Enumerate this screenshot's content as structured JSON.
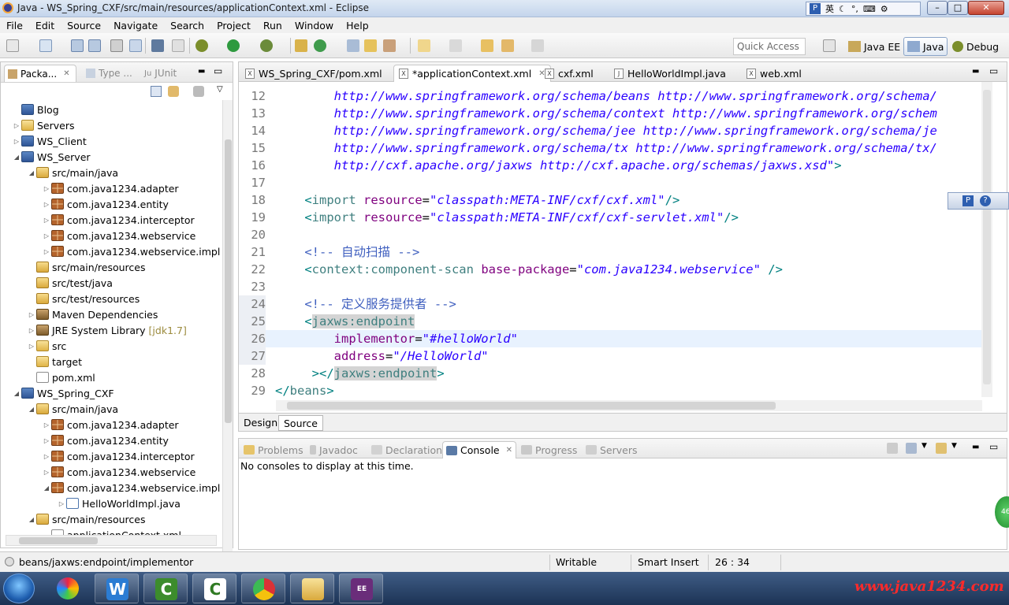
{
  "window": {
    "title": "Java - WS_Spring_CXF/src/main/resources/applicationContext.xml - Eclipse",
    "ime_label": "英"
  },
  "menu": [
    "File",
    "Edit",
    "Source",
    "Navigate",
    "Search",
    "Project",
    "Run",
    "Window",
    "Help"
  ],
  "toolbar": {
    "quick_access_placeholder": "Quick Access",
    "perspectives": [
      {
        "label": "Java EE",
        "active": false
      },
      {
        "label": "Java",
        "active": true
      },
      {
        "label": "Debug",
        "active": false
      }
    ]
  },
  "package_explorer": {
    "tabs": [
      {
        "label": "Packa...",
        "active": true
      },
      {
        "label": "Type ...",
        "active": false
      },
      {
        "label": "JUnit",
        "active": false
      }
    ],
    "items": [
      {
        "label": "Blog",
        "icon": "project-icon",
        "depth": 0,
        "expanded": null
      },
      {
        "label": "Servers",
        "icon": "folder-icon",
        "depth": 0,
        "expanded": false
      },
      {
        "label": "WS_Client",
        "icon": "project-icon",
        "depth": 0,
        "expanded": false
      },
      {
        "label": "WS_Server",
        "icon": "project-icon",
        "depth": 0,
        "expanded": true
      },
      {
        "label": "src/main/java",
        "icon": "source-folder-icon",
        "depth": 1,
        "expanded": true
      },
      {
        "label": "com.java1234.adapter",
        "icon": "package-icon",
        "depth": 2,
        "expanded": false
      },
      {
        "label": "com.java1234.entity",
        "icon": "package-icon",
        "depth": 2,
        "expanded": false
      },
      {
        "label": "com.java1234.interceptor",
        "icon": "package-icon",
        "depth": 2,
        "expanded": false
      },
      {
        "label": "com.java1234.webservice",
        "icon": "package-icon",
        "depth": 2,
        "expanded": false
      },
      {
        "label": "com.java1234.webservice.impl",
        "icon": "package-icon",
        "depth": 2,
        "expanded": false
      },
      {
        "label": "src/main/resources",
        "icon": "source-folder-icon",
        "depth": 1,
        "expanded": null
      },
      {
        "label": "src/test/java",
        "icon": "source-folder-icon",
        "depth": 1,
        "expanded": null
      },
      {
        "label": "src/test/resources",
        "icon": "source-folder-icon",
        "depth": 1,
        "expanded": null
      },
      {
        "label": "Maven Dependencies",
        "icon": "library-icon",
        "depth": 1,
        "expanded": false
      },
      {
        "label": "JRE System Library",
        "decoration": "[jdk1.7]",
        "icon": "library-icon",
        "depth": 1,
        "expanded": false
      },
      {
        "label": "src",
        "icon": "folder-icon",
        "depth": 1,
        "expanded": false
      },
      {
        "label": "target",
        "icon": "folder-icon",
        "depth": 1,
        "expanded": null
      },
      {
        "label": "pom.xml",
        "icon": "xml-file-icon",
        "depth": 1,
        "expanded": null
      },
      {
        "label": "WS_Spring_CXF",
        "icon": "project-icon",
        "depth": 0,
        "expanded": true
      },
      {
        "label": "src/main/java",
        "icon": "source-folder-icon",
        "depth": 1,
        "expanded": true
      },
      {
        "label": "com.java1234.adapter",
        "icon": "package-icon",
        "depth": 2,
        "expanded": false
      },
      {
        "label": "com.java1234.entity",
        "icon": "package-icon",
        "depth": 2,
        "expanded": false
      },
      {
        "label": "com.java1234.interceptor",
        "icon": "package-icon",
        "depth": 2,
        "expanded": false
      },
      {
        "label": "com.java1234.webservice",
        "icon": "package-icon",
        "depth": 2,
        "expanded": false
      },
      {
        "label": "com.java1234.webservice.impl",
        "icon": "package-icon",
        "depth": 2,
        "expanded": true
      },
      {
        "label": "HelloWorldImpl.java",
        "icon": "java-file-icon",
        "depth": 3,
        "expanded": false
      },
      {
        "label": "src/main/resources",
        "icon": "source-folder-icon",
        "depth": 1,
        "expanded": true
      },
      {
        "label": "applicationContext.xml",
        "icon": "xml-file-icon",
        "depth": 2,
        "expanded": null
      }
    ]
  },
  "editor": {
    "tabs": [
      {
        "label": "WS_Spring_CXF/pom.xml",
        "active": false
      },
      {
        "label": "*applicationContext.xml",
        "active": true
      },
      {
        "label": "cxf.xml",
        "active": false
      },
      {
        "label": "HelloWorldImpl.java",
        "active": false
      },
      {
        "label": "web.xml",
        "active": false
      }
    ],
    "current_line": 26,
    "lines": [
      {
        "n": 12,
        "parts": [
          [
            "url",
            "        http://www.springframework.org/schema/beans http://www.springframework.org/schema/"
          ]
        ]
      },
      {
        "n": 13,
        "parts": [
          [
            "url",
            "        http://www.springframework.org/schema/context http://www.springframework.org/schem"
          ]
        ]
      },
      {
        "n": 14,
        "parts": [
          [
            "url",
            "        http://www.springframework.org/schema/jee http://www.springframework.org/schema/je"
          ]
        ]
      },
      {
        "n": 15,
        "parts": [
          [
            "url",
            "        http://www.springframework.org/schema/tx http://www.springframework.org/schema/tx/"
          ]
        ]
      },
      {
        "n": 16,
        "parts": [
          [
            "url",
            "        http://cxf.apache.org/jaxws http://cxf.apache.org/schemas/jaxws.xsd\""
          ],
          [
            "bracket",
            ">"
          ]
        ]
      },
      {
        "n": 17,
        "parts": []
      },
      {
        "n": 18,
        "parts": [
          [
            "bracket",
            "    <"
          ],
          [
            "tag",
            "import "
          ],
          [
            "attr",
            "resource"
          ],
          [
            "plain",
            "="
          ],
          [
            "str",
            "\"classpath:META-INF/cxf/cxf.xml\""
          ],
          [
            "bracket",
            "/>"
          ]
        ]
      },
      {
        "n": 19,
        "parts": [
          [
            "bracket",
            "    <"
          ],
          [
            "tag",
            "import "
          ],
          [
            "attr",
            "resource"
          ],
          [
            "plain",
            "="
          ],
          [
            "str",
            "\"classpath:META-INF/cxf/cxf-servlet.xml\""
          ],
          [
            "bracket",
            "/>"
          ]
        ]
      },
      {
        "n": 20,
        "parts": []
      },
      {
        "n": 21,
        "parts": [
          [
            "cmt",
            "    <!-- 自动扫描 -->"
          ]
        ]
      },
      {
        "n": 22,
        "parts": [
          [
            "bracket",
            "    <"
          ],
          [
            "tag",
            "context:component-scan "
          ],
          [
            "attr",
            "base-package"
          ],
          [
            "plain",
            "="
          ],
          [
            "str",
            "\"com.java1234.webservice\""
          ],
          [
            "bracket",
            " />"
          ]
        ]
      },
      {
        "n": 23,
        "parts": []
      },
      {
        "n": 24,
        "parts": [
          [
            "cmt",
            "    <!-- 定义服务提供者 -->"
          ]
        ]
      },
      {
        "n": 25,
        "parts": [
          [
            "bracket",
            "    <"
          ],
          [
            "hltag",
            "jaxws:endpoint"
          ]
        ]
      },
      {
        "n": 26,
        "parts": [
          [
            "attr",
            "        implementor"
          ],
          [
            "plain",
            "="
          ],
          [
            "str",
            "\"#helloWorld\""
          ]
        ]
      },
      {
        "n": 27,
        "parts": [
          [
            "attr",
            "        address"
          ],
          [
            "plain",
            "="
          ],
          [
            "str",
            "\"/HelloWorld\""
          ]
        ]
      },
      {
        "n": 28,
        "parts": [
          [
            "bracket",
            "     ></"
          ],
          [
            "hltag",
            "jaxws:endpoint"
          ],
          [
            "bracket",
            ">"
          ]
        ]
      },
      {
        "n": 29,
        "parts": [
          [
            "bracket",
            "</"
          ],
          [
            "tag",
            "beans"
          ],
          [
            "bracket",
            ">"
          ]
        ]
      }
    ],
    "mode_tabs": [
      {
        "label": "Design",
        "active": false
      },
      {
        "label": "Source",
        "active": true
      }
    ]
  },
  "bottom_panel": {
    "tabs": [
      {
        "label": "Problems",
        "active": false,
        "icon": "problems-icon"
      },
      {
        "label": "Javadoc",
        "active": false,
        "icon": "javadoc-icon"
      },
      {
        "label": "Declaration",
        "active": false,
        "icon": "declaration-icon"
      },
      {
        "label": "Console",
        "active": true,
        "icon": "console-icon"
      },
      {
        "label": "Progress",
        "active": false,
        "icon": "progress-icon"
      },
      {
        "label": "Servers",
        "active": false,
        "icon": "servers-icon"
      }
    ],
    "message": "No consoles to display at this time."
  },
  "statusbar": {
    "path": "beans/jaxws:endpoint/implementor",
    "mode": "Writable",
    "insert": "Smart Insert",
    "position": "26 : 34"
  },
  "overlay_badge": "46",
  "taskbar": {
    "apps": [
      "start-orb",
      "flash-app",
      "word-app",
      "camtasia-app-1",
      "camtasia-app-2",
      "chrome-app",
      "explorer-app",
      "java-ee-app"
    ],
    "watermark": "www.java1234.com"
  },
  "colors": {
    "url": "#2a00ff",
    "tag": "#3f7f7f",
    "attr": "#7f007f",
    "comment": "#3f5fbf",
    "current_line": "#e8f2fe"
  }
}
